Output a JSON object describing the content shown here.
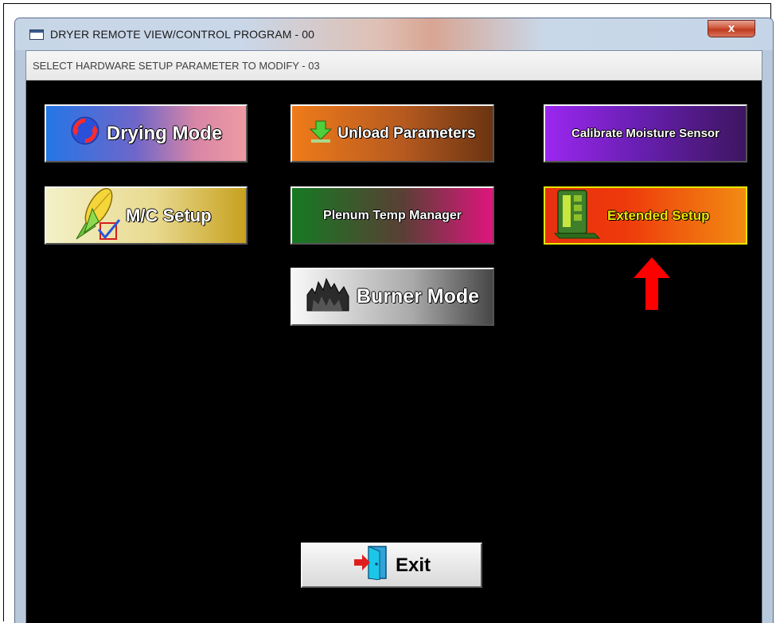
{
  "window": {
    "title": "DRYER REMOTE VIEW/CONTROL PROGRAM - 00",
    "close_label": "x"
  },
  "header": {
    "subtitle": "SELECT HARDWARE SETUP PARAMETER TO MODIFY - 03"
  },
  "buttons": {
    "drying_mode": "Drying Mode",
    "unload_parameters": "Unload Parameters",
    "calibrate_moisture_sensor": "Calibrate Moisture Sensor",
    "mc_setup": "M/C Setup",
    "plenum_temp_manager": "Plenum Temp Manager",
    "extended_setup": "Extended Setup",
    "burner_mode": "Burner Mode",
    "exit": "Exit"
  },
  "icons": {
    "drying_mode": "refresh-cycle-icon",
    "unload_parameters": "download-arrow-icon",
    "mc_setup": "corn-cob-icon",
    "extended_setup": "control-panel-icon",
    "burner_mode": "burner-flame-icon",
    "exit": "exit-door-icon",
    "annotation": "red-up-arrow"
  },
  "colors": {
    "canvas": "#000000",
    "highlight_border": "#e6e600",
    "annotation_arrow": "#ff0000"
  }
}
